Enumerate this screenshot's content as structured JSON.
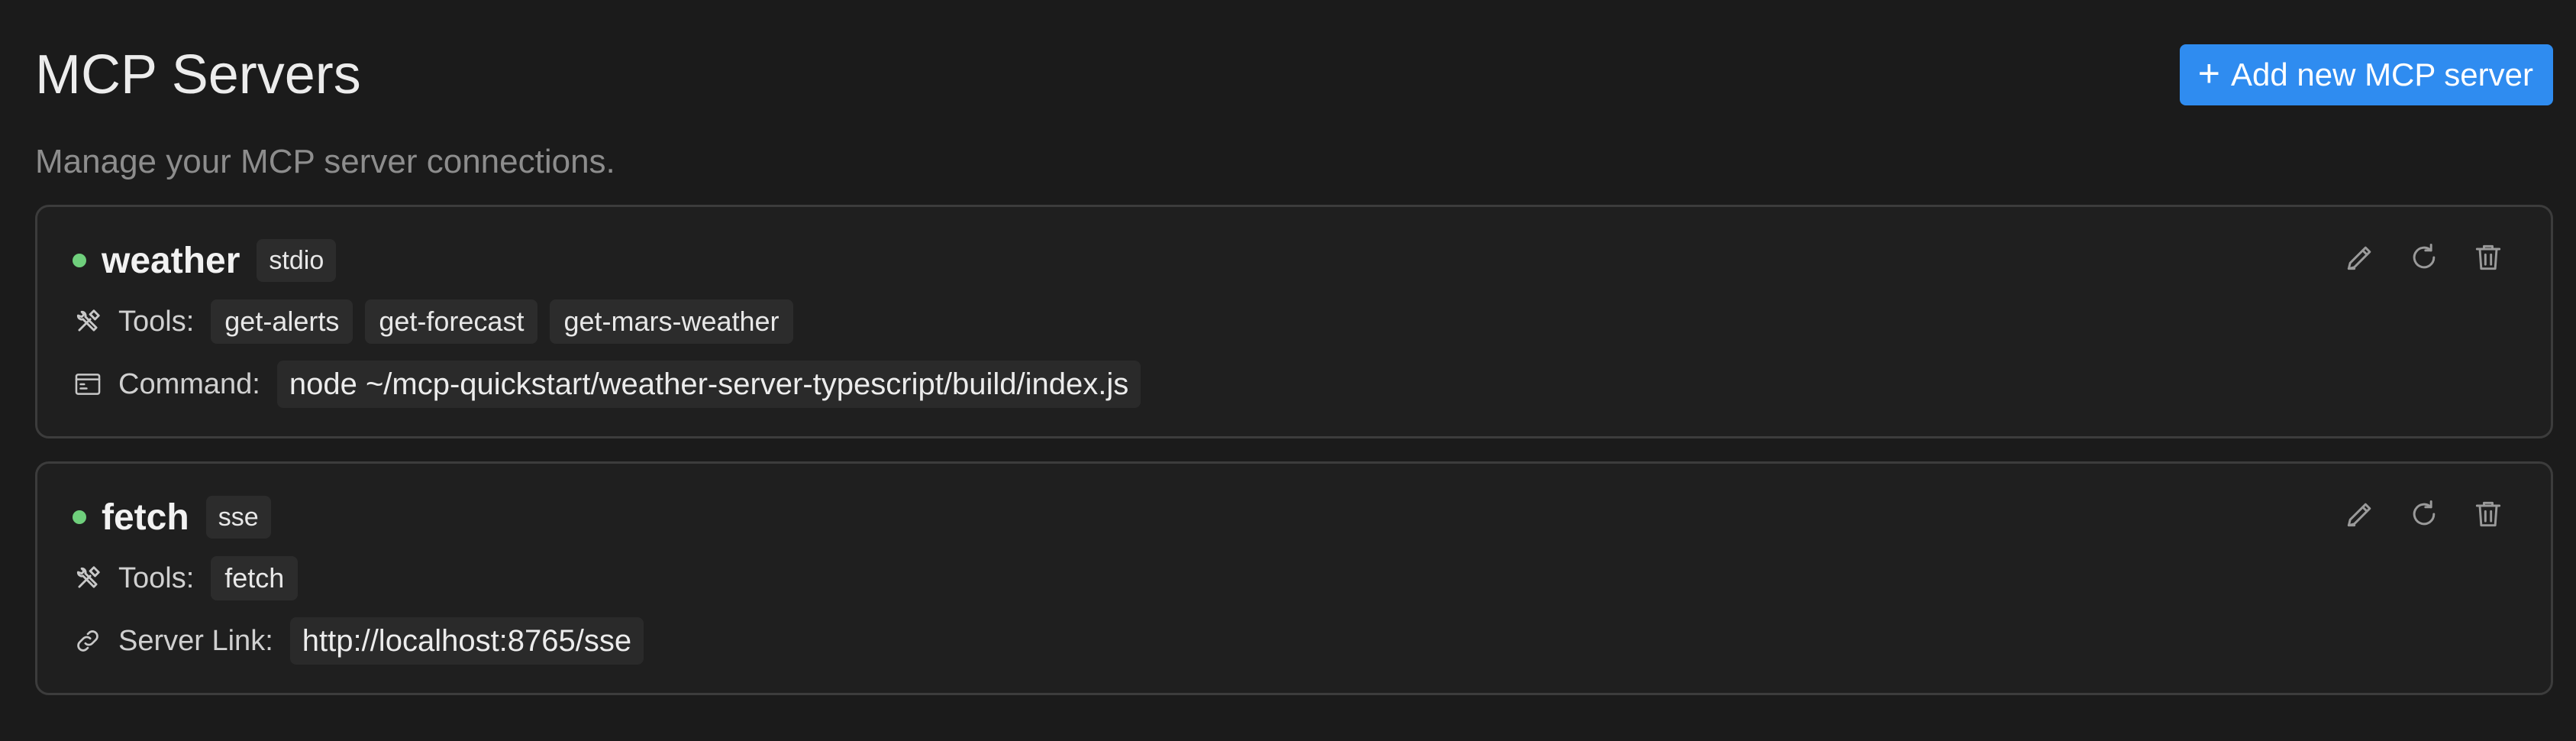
{
  "header": {
    "title": "MCP Servers",
    "subtitle": "Manage your MCP server connections.",
    "add_button_label": "Add new MCP server"
  },
  "colors": {
    "accent": "#2f8cf0",
    "status_connected": "#6fcf7c",
    "background": "#1b1b1b"
  },
  "servers": [
    {
      "name": "weather",
      "type": "stdio",
      "status": "connected",
      "tools_label": "Tools:",
      "tools": [
        "get-alerts",
        "get-forecast",
        "get-mars-weather"
      ],
      "extra_label": "Command:",
      "extra_value": "node ~/mcp-quickstart/weather-server-typescript/build/index.js",
      "extra_icon": "terminal-icon"
    },
    {
      "name": "fetch",
      "type": "sse",
      "status": "connected",
      "tools_label": "Tools:",
      "tools": [
        "fetch"
      ],
      "extra_label": "Server Link:",
      "extra_value": "http://localhost:8765/sse",
      "extra_icon": "link-icon"
    }
  ],
  "icons": {
    "tools": "tools-icon",
    "edit": "pencil-icon",
    "refresh": "refresh-icon",
    "delete": "trash-icon"
  }
}
